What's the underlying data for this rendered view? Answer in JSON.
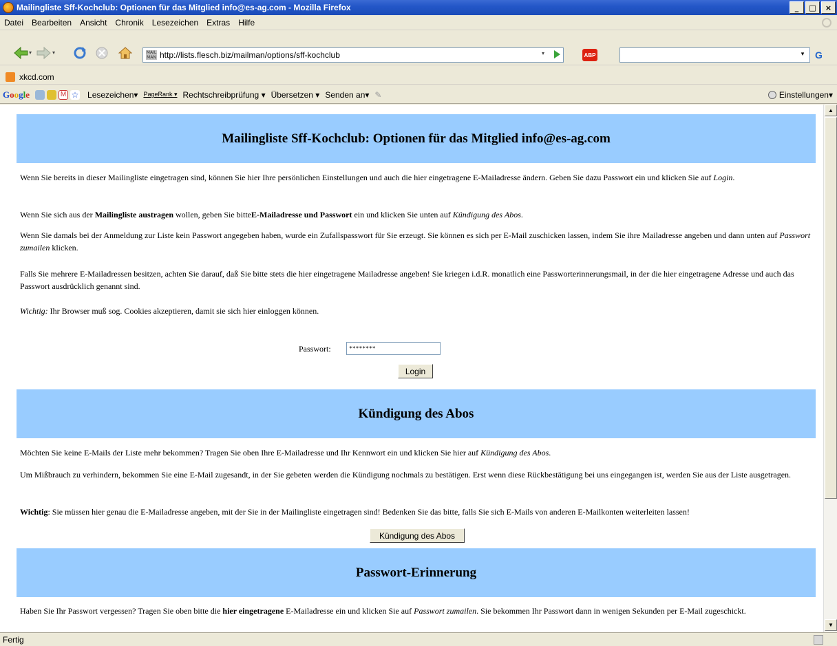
{
  "window": {
    "title": "Mailingliste Sff-Kochclub: Optionen für das Mitglied info@es-ag.com - Mozilla Firefox",
    "minimize": "_",
    "maximize": "□",
    "close": "×"
  },
  "menu": [
    "Datei",
    "Bearbeiten",
    "Ansicht",
    "Chronik",
    "Lesezeichen",
    "Extras",
    "Hilfe"
  ],
  "navigation": {
    "url": "http://lists.flesch.biz/mailman/options/sff-kochclub",
    "site_icon_text": "MAIL MAN",
    "adblock_label": "ABP",
    "search_value": "",
    "search_engine_label": "G"
  },
  "bookmarks": {
    "items": [
      "xkcd.com"
    ]
  },
  "google_toolbar": {
    "logo": [
      "G",
      "o",
      "o",
      "g",
      "l",
      "e"
    ],
    "items": [
      "Lesezeichen▾",
      "PageRank ▾",
      "Rechtschreibprüfung ▾",
      "Übersetzen ▾",
      "Senden an▾"
    ],
    "settings": "Einstellungen▾"
  },
  "page": {
    "heading": "Mailingliste Sff-Kochclub: Optionen für das Mitglied info@es-ag.com",
    "intro": {
      "p1_a": "Wenn Sie bereits in dieser Mailingliste eingetragen sind, können Sie hier Ihre persönlichen Einstellungen und auch die hier eingetragene E-Mailadresse ändern. Geben Sie dazu Passwort ein und klicken Sie auf ",
      "p1_em": "Login",
      "p1_b": ".",
      "p2_a": "Wenn Sie sich aus der ",
      "p2_strong1": "Mailingliste austragen",
      "p2_b": " wollen, geben Sie bitte",
      "p2_strong2": "E-Mailadresse und Passwort",
      "p2_c": " ein und klicken Sie unten auf ",
      "p2_em": "Kündigung des Abos",
      "p2_d": ".",
      "p3_a": "Wenn Sie damals bei der Anmeldung zur Liste kein Passwort angegeben haben, wurde ein Zufallspasswort für Sie erzeugt. Sie können es sich per E-Mail zuschicken lassen, indem Sie ihre Mailadresse angeben und dann unten auf ",
      "p3_em": "Passwort zumailen",
      "p3_b": " klicken.",
      "p4": "Falls Sie mehrere E-Mailadressen besitzen, achten Sie darauf, daß Sie bitte stets die hier eingetragene Mailadresse angeben! Sie kriegen i.d.R. monatlich eine Passworterinnerungsmail, in der die hier eingetragene Adresse und auch das Passwort ausdrücklich genannt sind.",
      "p5_em": "Wichtig:",
      "p5_b": " Ihr Browser muß sog. Cookies akzeptieren, damit sie sich hier einloggen können."
    },
    "login": {
      "password_label": "Passwort:",
      "password_value": "********",
      "login_button": "Login"
    },
    "unsubscribe": {
      "heading": "Kündigung des Abos",
      "p1_a": "Möchten Sie keine E-Mails der Liste mehr bekommen? Tragen Sie oben Ihre E-Mailadresse und Ihr Kennwort ein und klicken Sie hier auf ",
      "p1_em": "Kündigung des Abos",
      "p1_b": ".",
      "p2": "Um Mißbrauch zu verhindern, bekommen Sie eine E-Mail zugesandt, in der Sie gebeten werden die Kündigung nochmals zu bestätigen. Erst wenn diese Rückbestätigung bei uns eingegangen ist, werden Sie aus der Liste ausgetragen.",
      "p3_strong": "Wichtig",
      "p3_b": ": Sie müssen hier genau die E-Mailadresse angeben, mit der Sie in der Mailingliste eingetragen sind! Bedenken Sie das bitte, falls Sie sich E-Mails von anderen E-Mailkonten weiterleiten lassen!",
      "button": "Kündigung des Abos"
    },
    "reminder": {
      "heading": "Passwort-Erinnerung",
      "p1_a": "Haben Sie Ihr Passwort vergessen? Tragen Sie oben bitte die ",
      "p1_strong": "hier eingetragene",
      "p1_b": " E-Mailadresse ein und klicken Sie auf ",
      "p1_em": "Passwort zumailen",
      "p1_c": ". Sie bekommen Ihr Passwort dann in wenigen Sekunden per E-Mail zugeschickt."
    }
  },
  "status": {
    "text": "Fertig"
  },
  "colors": {
    "section_header": "#99ccff",
    "titlebar": "#2457c8",
    "chrome": "#ece9d8"
  }
}
